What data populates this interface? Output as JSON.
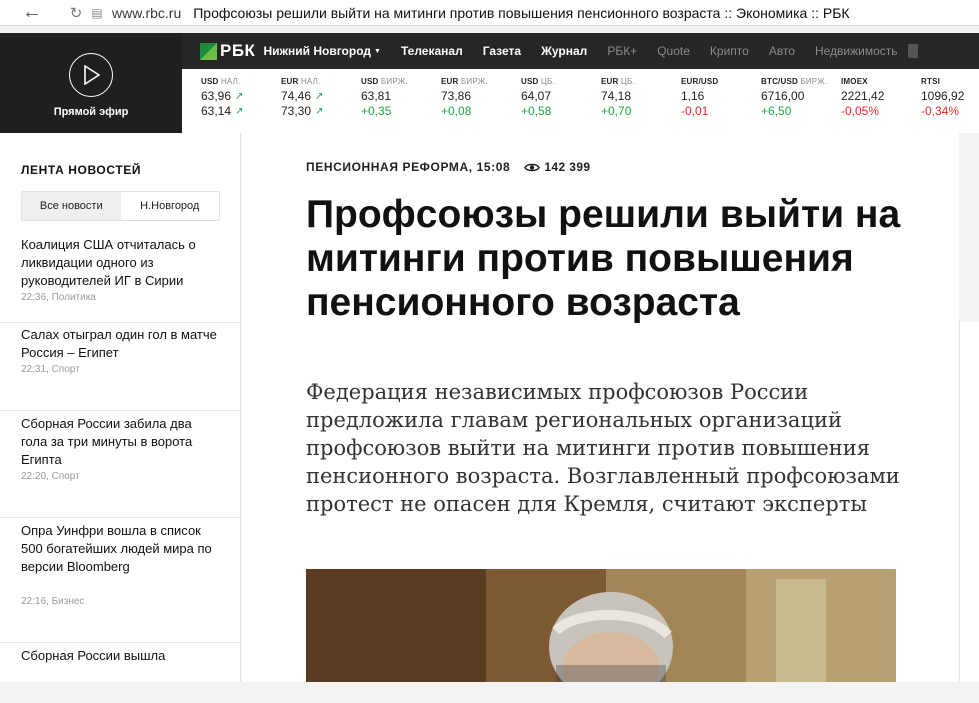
{
  "browser": {
    "url_domain": "www.rbc.ru",
    "page_title": "Профсоюзы решили выйти на митинги против повышения пенсионного возраста :: Экономика :: РБК"
  },
  "header": {
    "live_label": "Прямой эфир",
    "logo_text": "РБК",
    "city": "Нижний Новгород",
    "nav": [
      {
        "label": "Телеканал",
        "dim": false
      },
      {
        "label": "Газета",
        "dim": false
      },
      {
        "label": "Журнал",
        "dim": false
      },
      {
        "label": "РБК+",
        "dim": true
      },
      {
        "label": "Quote",
        "dim": true
      },
      {
        "label": "Крипто",
        "dim": true
      },
      {
        "label": "Авто",
        "dim": true
      },
      {
        "label": "Недвижимость",
        "dim": true
      }
    ],
    "tickers": [
      {
        "label": "USD",
        "sub": "НАЛ.",
        "v1": "63,96",
        "v2": "63,14",
        "v2_type": "value",
        "arrows": true
      },
      {
        "label": "EUR",
        "sub": "НАЛ.",
        "v1": "74,46",
        "v2": "73,30",
        "v2_type": "value",
        "arrows": true
      },
      {
        "label": "USD",
        "sub": "БИРЖ.",
        "v1": "63,81",
        "v2": "+0,35",
        "v2_type": "pos",
        "arrows": false
      },
      {
        "label": "EUR",
        "sub": "БИРЖ.",
        "v1": "73,86",
        "v2": "+0,08",
        "v2_type": "pos",
        "arrows": false
      },
      {
        "label": "USD",
        "sub": "ЦБ.",
        "v1": "64,07",
        "v2": "+0,58",
        "v2_type": "pos",
        "arrows": false
      },
      {
        "label": "EUR",
        "sub": "ЦБ.",
        "v1": "74,18",
        "v2": "+0,70",
        "v2_type": "pos",
        "arrows": false
      },
      {
        "label": "EUR/USD",
        "sub": "",
        "v1": "1,16",
        "v2": "-0,01",
        "v2_type": "neg",
        "arrows": false
      },
      {
        "label": "BTC/USD",
        "sub": "БИРЖ.",
        "v1": "6716,00",
        "v2": "+6,50",
        "v2_type": "pos",
        "arrows": false
      },
      {
        "label": "IMOEX",
        "sub": "",
        "v1": "2221,42",
        "v2": "-0,05%",
        "v2_type": "neg",
        "arrows": false
      },
      {
        "label": "RTSI",
        "sub": "",
        "v1": "1096,92",
        "v2": "-0,34%",
        "v2_type": "neg",
        "arrows": false
      }
    ]
  },
  "feed": {
    "heading": "ЛЕНТА НОВОСТЕЙ",
    "tabs": [
      "Все новости",
      "Н.Новгород"
    ],
    "items": [
      {
        "title": "Коалиция США отчиталась о ликвидации одного из руководителей ИГ в Сирии",
        "meta": "22:36, Политика"
      },
      {
        "title": "Салах отыграл один гол в матче Россия – Египет",
        "meta": "22:31, Спорт"
      },
      {
        "title": "Сборная России забила два гола за три минуты в ворота Египта",
        "meta": "22:20, Спорт"
      },
      {
        "title": "Опра Уинфри вошла в список 500 богатейших людей мира по версии Bloomberg",
        "meta": "22:16, Бизнес"
      },
      {
        "title": "Сборная России вышла",
        "meta": ""
      }
    ]
  },
  "article": {
    "rubric": "ПЕНСИОННАЯ РЕФОРМА, 15:08",
    "views": "142 399",
    "headline": "Профсоюзы решили выйти на митинги против повышения пенсионного возраста",
    "lead": "Федерация независимых профсоюзов России предложила главам региональных организаций профсоюзов выйти на митинги против повышения пенсионного возраста. Возглавленный профсоюзами протест не опасен для Кремля, считают эксперты"
  }
}
